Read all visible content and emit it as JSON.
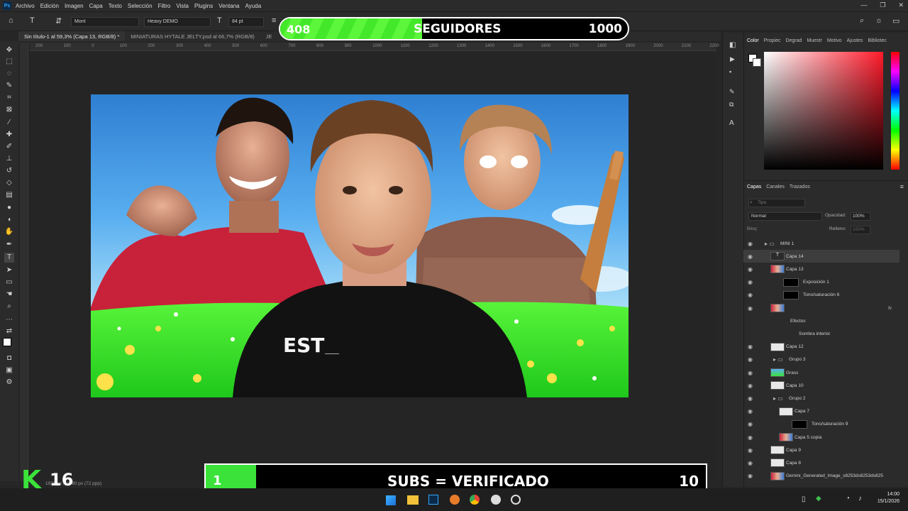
{
  "menubar": {
    "logo": "Ps",
    "items": [
      "Archivo",
      "Edición",
      "Imagen",
      "Capa",
      "Texto",
      "Selección",
      "Filtro",
      "Vista",
      "Plugins",
      "Ventana",
      "Ayuda"
    ]
  },
  "options": {
    "font_family": "Mont",
    "font_style": "Heavy DEMO",
    "font_size": "84 pt"
  },
  "tabs": [
    {
      "label": "Sin título-1 al 59,3% (Capa 13, RGB/8) *",
      "active": true
    },
    {
      "label": "MINIATURAS HYTALE JELTY.psd al 66,7% (RGB/8)",
      "active": false
    },
    {
      "label": "JE",
      "active": false
    }
  ],
  "ruler_ticks": [
    "200",
    "100",
    "0",
    "100",
    "200",
    "300",
    "400",
    "500",
    "600",
    "700",
    "800",
    "900",
    "1000",
    "1100",
    "1200",
    "1300",
    "1400",
    "1500",
    "1600",
    "1700",
    "1800",
    "1900",
    "2000",
    "2100",
    "2200"
  ],
  "canvas": {
    "typed_text": "EST"
  },
  "status_bar": {
    "doc_info": "1928 px x 1080 px (72 ppp)"
  },
  "follower_goal": {
    "current": "408",
    "label": "SEGUIDORES",
    "target": "1000",
    "progress": 0.408
  },
  "subs_goal": {
    "current": "1",
    "label": "SUBS = VERIFICADO",
    "target": "10",
    "progress": 0.1
  },
  "stream_logo": {
    "letter": "K",
    "number": "16",
    "color": "#3be23a"
  },
  "color_panel": {
    "tabs": [
      "Color",
      "Propiec",
      "Degrad",
      "Muestr",
      "Motivo",
      "Ajustes",
      "Bibliotec"
    ]
  },
  "layers_panel": {
    "tabs": [
      "Capas",
      "Canales",
      "Trazados"
    ],
    "search_placeholder": "Tipo",
    "blend_mode": "Normal",
    "opacity_label": "Opacidad:",
    "opacity": "100%",
    "lock_label": "Bloq:",
    "fill_label": "Relleno:",
    "fill": "100%",
    "layers": [
      {
        "name": "MINI 1",
        "type": "group",
        "indent": 0
      },
      {
        "name": "Capa 14",
        "type": "text",
        "indent": 1,
        "selected": true
      },
      {
        "name": "Capa 13",
        "type": "image",
        "indent": 1
      },
      {
        "name": "Exposición 1",
        "type": "adjust",
        "indent": 1
      },
      {
        "name": "Tono/saturación 6",
        "type": "adjust",
        "indent": 1
      },
      {
        "name": "",
        "type": "image",
        "indent": 1,
        "fx": "fx"
      },
      {
        "name": "Efectos",
        "type": "effect",
        "indent": 2
      },
      {
        "name": "Sombra interior",
        "type": "effect",
        "indent": 3
      },
      {
        "name": "Capa 12",
        "type": "blank",
        "indent": 1
      },
      {
        "name": "Grupo 3",
        "type": "group",
        "indent": 1
      },
      {
        "name": "Grass",
        "type": "grass",
        "indent": 1
      },
      {
        "name": "Capa 10",
        "type": "blank",
        "indent": 1
      },
      {
        "name": "Grupo 2",
        "type": "group",
        "indent": 1
      },
      {
        "name": "Capa 7",
        "type": "blank",
        "indent": 2
      },
      {
        "name": "Tono/saturación 9",
        "type": "adjust",
        "indent": 2
      },
      {
        "name": "Capa 5 copia",
        "type": "image",
        "indent": 2
      },
      {
        "name": "Capa 9",
        "type": "blank",
        "indent": 1
      },
      {
        "name": "Capa 8",
        "type": "blank",
        "indent": 1
      },
      {
        "name": "Gemini_Generated_Image_s8253ds8253ds825",
        "type": "image",
        "indent": 1
      }
    ]
  },
  "clock": {
    "time": "14:00",
    "date": "15/1/2026"
  }
}
